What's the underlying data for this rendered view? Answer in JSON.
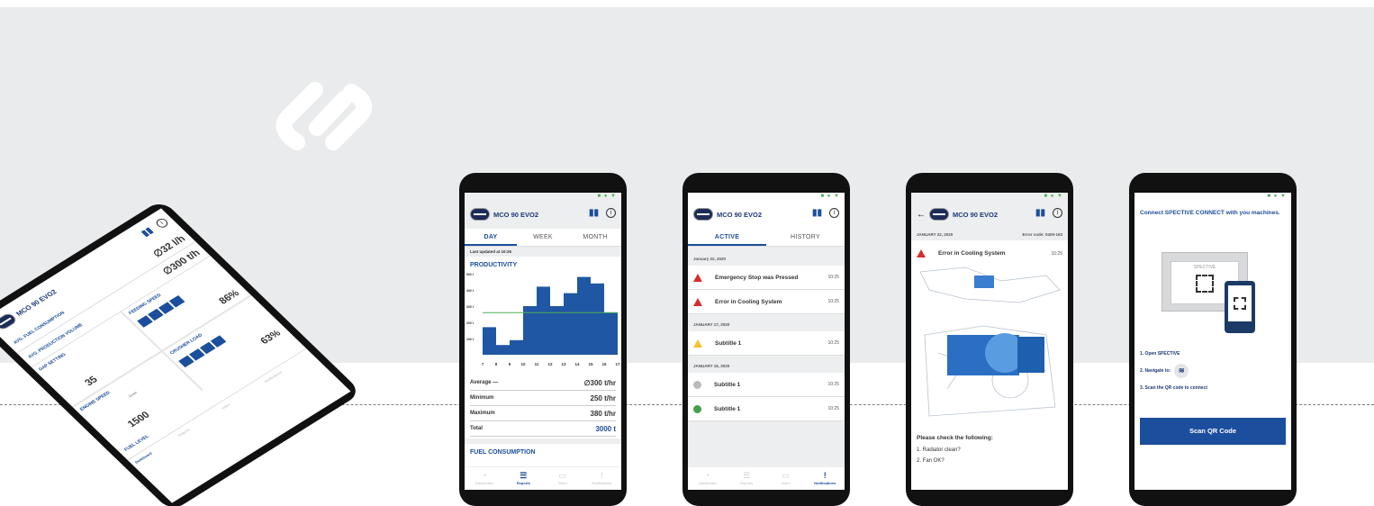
{
  "colors": {
    "brand": "#1b4e9c",
    "danger": "#d32f2f",
    "warning": "#fbc02d",
    "ok": "#43a047",
    "line": "#4caf50"
  },
  "machine": "MCO 90 EVO2",
  "tilted": {
    "metrics": [
      {
        "label": "AVG. FUEL CONSUMPTION",
        "value": "∅32 l/h"
      },
      {
        "label": "AVG. PRODUCTION VOLUME",
        "value": "∅300 t/h"
      }
    ],
    "cells": [
      {
        "label": "GAP SETTING",
        "value": "35"
      },
      {
        "label": "FEEDING SPEED",
        "value": "86%"
      },
      {
        "label": "ENGINE SPEED",
        "value": "1500",
        "unit": "1/min"
      },
      {
        "label": "CRUSHER LOAD",
        "value": "63%"
      }
    ],
    "fuel_label": "FUEL LEVEL",
    "nav": [
      "Dashboard",
      "Reports",
      "Video",
      "Notifications"
    ]
  },
  "reports": {
    "tabs": [
      "DAY",
      "WEEK",
      "MONTH"
    ],
    "updated": "Last updated at 10:25",
    "section": "PRODUCTIVITY",
    "summary": [
      {
        "label": "Average —",
        "value": "∅300 t/hr"
      },
      {
        "label": "Minimum",
        "value": "250 t/hr"
      },
      {
        "label": "Maximum",
        "value": "380 t/hr"
      },
      {
        "label": "Total",
        "value": "3000 t"
      }
    ],
    "section2": "FUEL CONSUMPTION"
  },
  "chart_data": {
    "type": "bar",
    "title": "PRODUCTIVITY",
    "categories": [
      "7",
      "8",
      "9",
      "10",
      "11",
      "12",
      "13",
      "14",
      "15",
      "16",
      "17"
    ],
    "values": [
      170,
      60,
      90,
      300,
      420,
      300,
      380,
      480,
      440,
      260
    ],
    "ytick_labels": [
      "500 t",
      "400 t",
      "300 t",
      "200 t",
      "100 t"
    ],
    "ylim": [
      0,
      500
    ],
    "average": 260
  },
  "notifications": {
    "tabs": [
      "ACTIVE",
      "HISTORY"
    ],
    "groups": [
      {
        "date": "January 22, 2020",
        "items": [
          {
            "icon": "warning-red",
            "title": "Emergency Stop was Pressed",
            "time": "10:25"
          },
          {
            "icon": "warning-red",
            "title": "Error in Cooling System",
            "time": "10:25"
          }
        ]
      },
      {
        "date": "JANUARY 17, 2020",
        "items": [
          {
            "icon": "warning-yellow",
            "title": "Subtitle 1",
            "time": "10:25"
          }
        ]
      },
      {
        "date": "JANUARY 15, 2020",
        "items": [
          {
            "icon": "gear-gray",
            "title": "Subtitle 1",
            "time": "10:25"
          },
          {
            "icon": "info-green",
            "title": "Subtitle 1",
            "time": "10:25"
          }
        ]
      }
    ]
  },
  "detail": {
    "date": "JANUARY 22, 2020",
    "code": "Error code: 0400-163",
    "title": "Error in Cooling System",
    "time": "10:25",
    "check_title": "Please check the following:",
    "checks": [
      "1. Radiator clean?",
      "2. Fan OK?"
    ]
  },
  "connect": {
    "intro": "Connect SPECTIVE CONNECT with you machines.",
    "brand": "SPECTIVE",
    "steps": [
      "1. Open SPECTIVE",
      "2. Navigate to:",
      "3. Scan the QR code to connect"
    ],
    "button": "Scan QR Code"
  },
  "nav": [
    {
      "label": "Dashboard",
      "icon": "gauge-icon"
    },
    {
      "label": "Reports",
      "icon": "list-icon"
    },
    {
      "label": "Video",
      "icon": "camera-icon"
    },
    {
      "label": "Notifications",
      "icon": "alert-icon"
    }
  ]
}
